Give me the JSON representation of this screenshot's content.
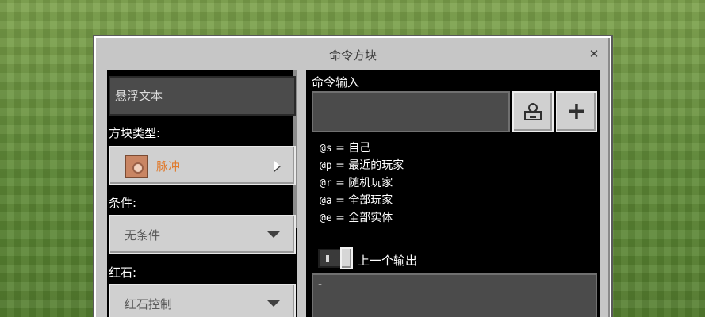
{
  "window": {
    "title": "命令方块",
    "close_label": "✕"
  },
  "left": {
    "hover_text": "悬浮文本",
    "block_type_label": "方块类型:",
    "block_type_value": "脉冲",
    "condition_label": "条件:",
    "condition_value": "无条件",
    "redstone_label": "红石:",
    "redstone_value": "红石控制"
  },
  "right": {
    "command_input_label": "命令输入",
    "command_input_value": "",
    "selectors": [
      {
        "code": "@s",
        "desc": "= 自己"
      },
      {
        "code": "@p",
        "desc": "= 最近的玩家"
      },
      {
        "code": "@r",
        "desc": "= 随机玩家"
      },
      {
        "code": "@a",
        "desc": "= 全部玩家"
      },
      {
        "code": "@e",
        "desc": "= 全部实体"
      }
    ],
    "previous_output_label": "上一个输出",
    "previous_output_value": "-"
  },
  "icons": {
    "block_type": "command-block-icon",
    "export": "structure-export-icon",
    "add": "plus-icon"
  },
  "colors": {
    "block_type_text": "#e07b2e",
    "panel_bg": "#000000",
    "window_bg": "#c6c6c6"
  }
}
